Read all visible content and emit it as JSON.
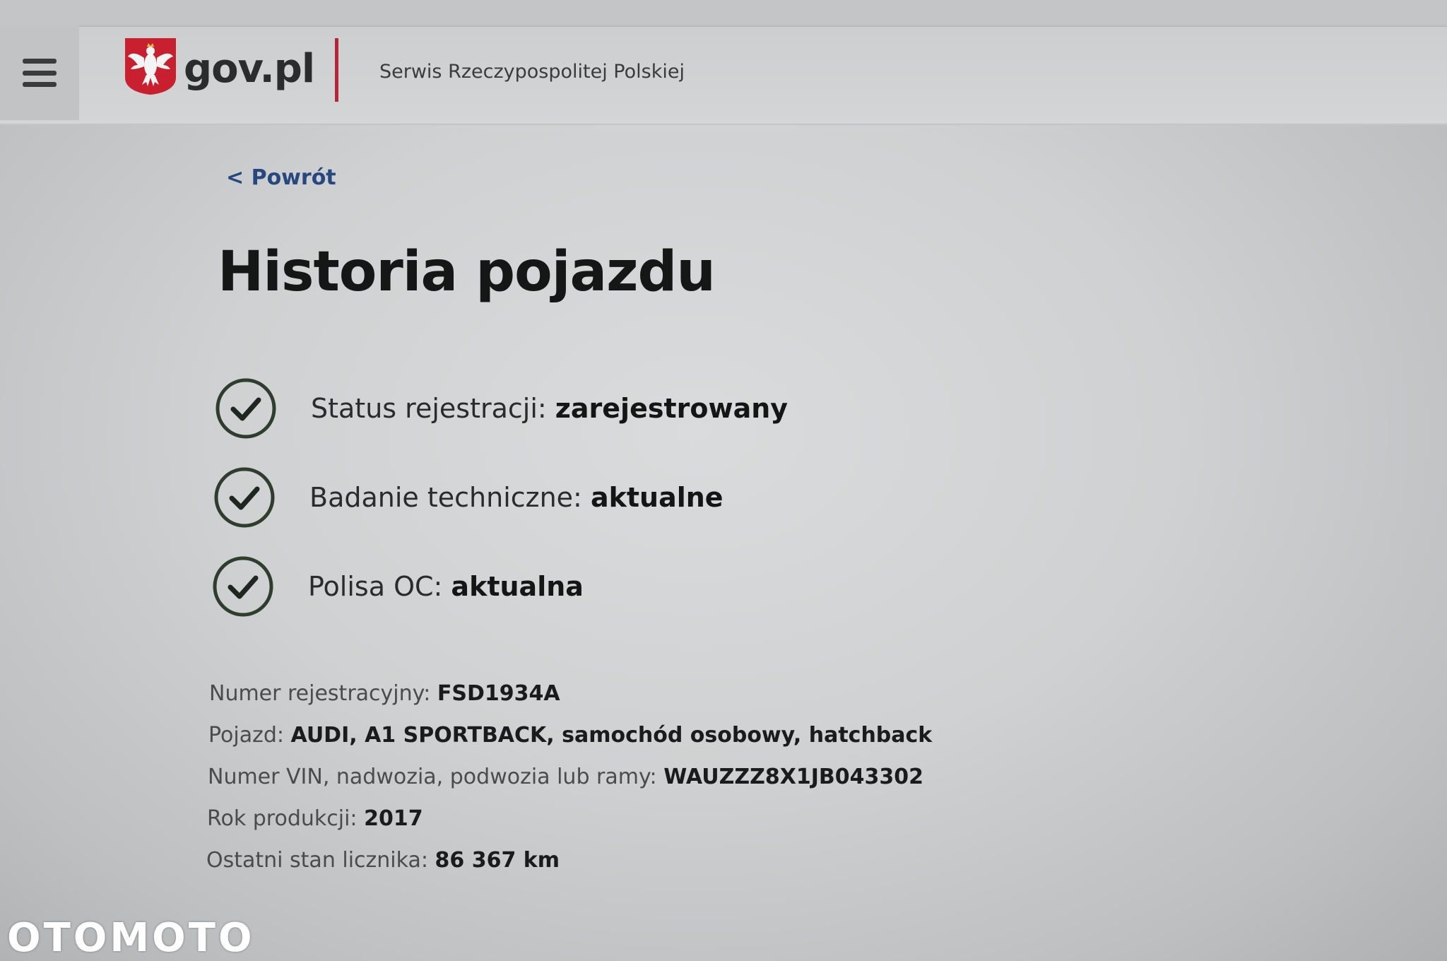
{
  "header": {
    "logo_text": "gov.pl",
    "subtitle": "Serwis Rzeczypospolitej Polskiej",
    "menu_icon": "hamburger-menu-icon",
    "emblem_icon": "polish-eagle-emblem-icon",
    "divider_color": "#b7243a"
  },
  "nav": {
    "back_label": "< Powrót",
    "link_color": "#27477f"
  },
  "page": {
    "title": "Historia pojazdu"
  },
  "status": [
    {
      "label": "Status rejestracji: ",
      "value": "zarejestrowany",
      "icon": "check-circle-icon"
    },
    {
      "label": "Badanie techniczne: ",
      "value": "aktualne",
      "icon": "check-circle-icon"
    },
    {
      "label": "Polisa OC: ",
      "value": "aktualna",
      "icon": "check-circle-icon"
    }
  ],
  "details": [
    {
      "label": "Numer rejestracyjny: ",
      "value": "FSD1934A"
    },
    {
      "label": "Pojazd: ",
      "value": "AUDI, A1 SPORTBACK, samochód osobowy, hatchback"
    },
    {
      "label": "Numer VIN, nadwozia, podwozia lub ramy: ",
      "value": "WAUZZZ8X1JB043302"
    },
    {
      "label": "Rok produkcji: ",
      "value": "2017"
    },
    {
      "label": "Ostatni stan licznika: ",
      "value": "86 367 km"
    }
  ],
  "watermark": {
    "text": "OTOMOTO"
  }
}
